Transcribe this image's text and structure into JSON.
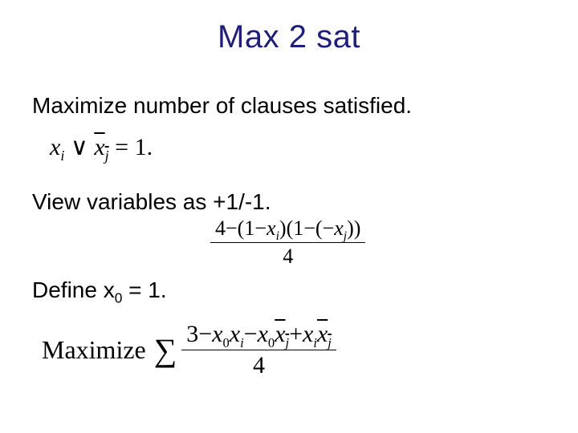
{
  "title": "Max 2 sat",
  "lines": {
    "maximize": "Maximize number of clauses satisfied.",
    "view": "View variables as +1/-1.",
    "define_pre": "Define x",
    "define_sub": "0",
    "define_post": " = 1."
  },
  "clause": {
    "xi_var": "x",
    "xi_sub": "i",
    "or": "∨",
    "xj_bar_var": "x",
    "xj_bar_sub": "j",
    "eq": "=",
    "rhs": "1",
    "dot": "."
  },
  "frac": {
    "num_a": "4",
    "num_minus1": "−",
    "num_open1": "(1",
    "num_minus2": "−",
    "num_x1": "x",
    "num_x1_sub": "i",
    "num_close1": ")(1",
    "num_minus3": "−",
    "num_open2": "(",
    "num_neg": "−",
    "num_x2": "x",
    "num_x2_sub": "j",
    "num_close2": "))",
    "den": "4"
  },
  "objective": {
    "word": "Maximize",
    "sigma": "∑",
    "num_3": "3",
    "minus": "−",
    "plus": "+",
    "x": "x",
    "sub0": "0",
    "subi": "i",
    "subj": "j",
    "den": "4"
  }
}
